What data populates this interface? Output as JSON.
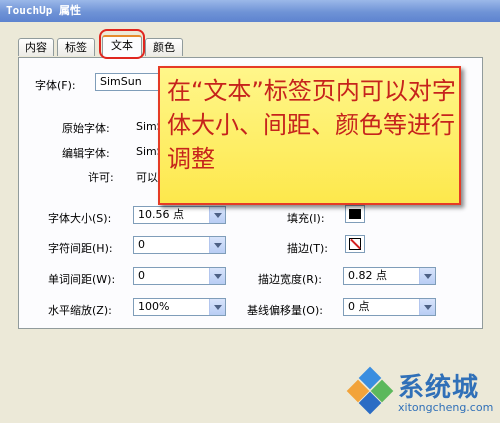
{
  "window": {
    "title": "TouchUp 属性"
  },
  "tabs": [
    "内容",
    "标签",
    "文本",
    "颜色"
  ],
  "font": {
    "label": "字体(F):",
    "value": "SimSun",
    "original_label": "原始字体:",
    "original_value": "SimS",
    "edit_label": "编辑字体:",
    "edit_value": "SimS",
    "permission_label": "许可:",
    "permission_value": "可以"
  },
  "font_size": {
    "label": "字体大小(S):",
    "value": "10.56 点"
  },
  "char_spacing": {
    "label": "字符间距(H):",
    "value": "0"
  },
  "word_spacing": {
    "label": "单词间距(W):",
    "value": "0"
  },
  "h_scale": {
    "label": "水平缩放(Z):",
    "value": "100%"
  },
  "fill": {
    "label": "填充(I):"
  },
  "stroke": {
    "label": "描边(T):"
  },
  "stroke_width": {
    "label": "描边宽度(R):",
    "value": "0.82 点"
  },
  "baseline": {
    "label": "基线偏移量(O):",
    "value": "0 点"
  },
  "callout": {
    "text": "在“文本”标签页内可以对字体大小、间距、颜色等进行调整"
  },
  "watermark": {
    "name": "系统城",
    "url": "xitongcheng.com"
  },
  "colors": {
    "callout_text": "#c6231c",
    "callout_border": "#e53b25",
    "highlight": "#e0261f",
    "watermark": "#3070b8"
  }
}
